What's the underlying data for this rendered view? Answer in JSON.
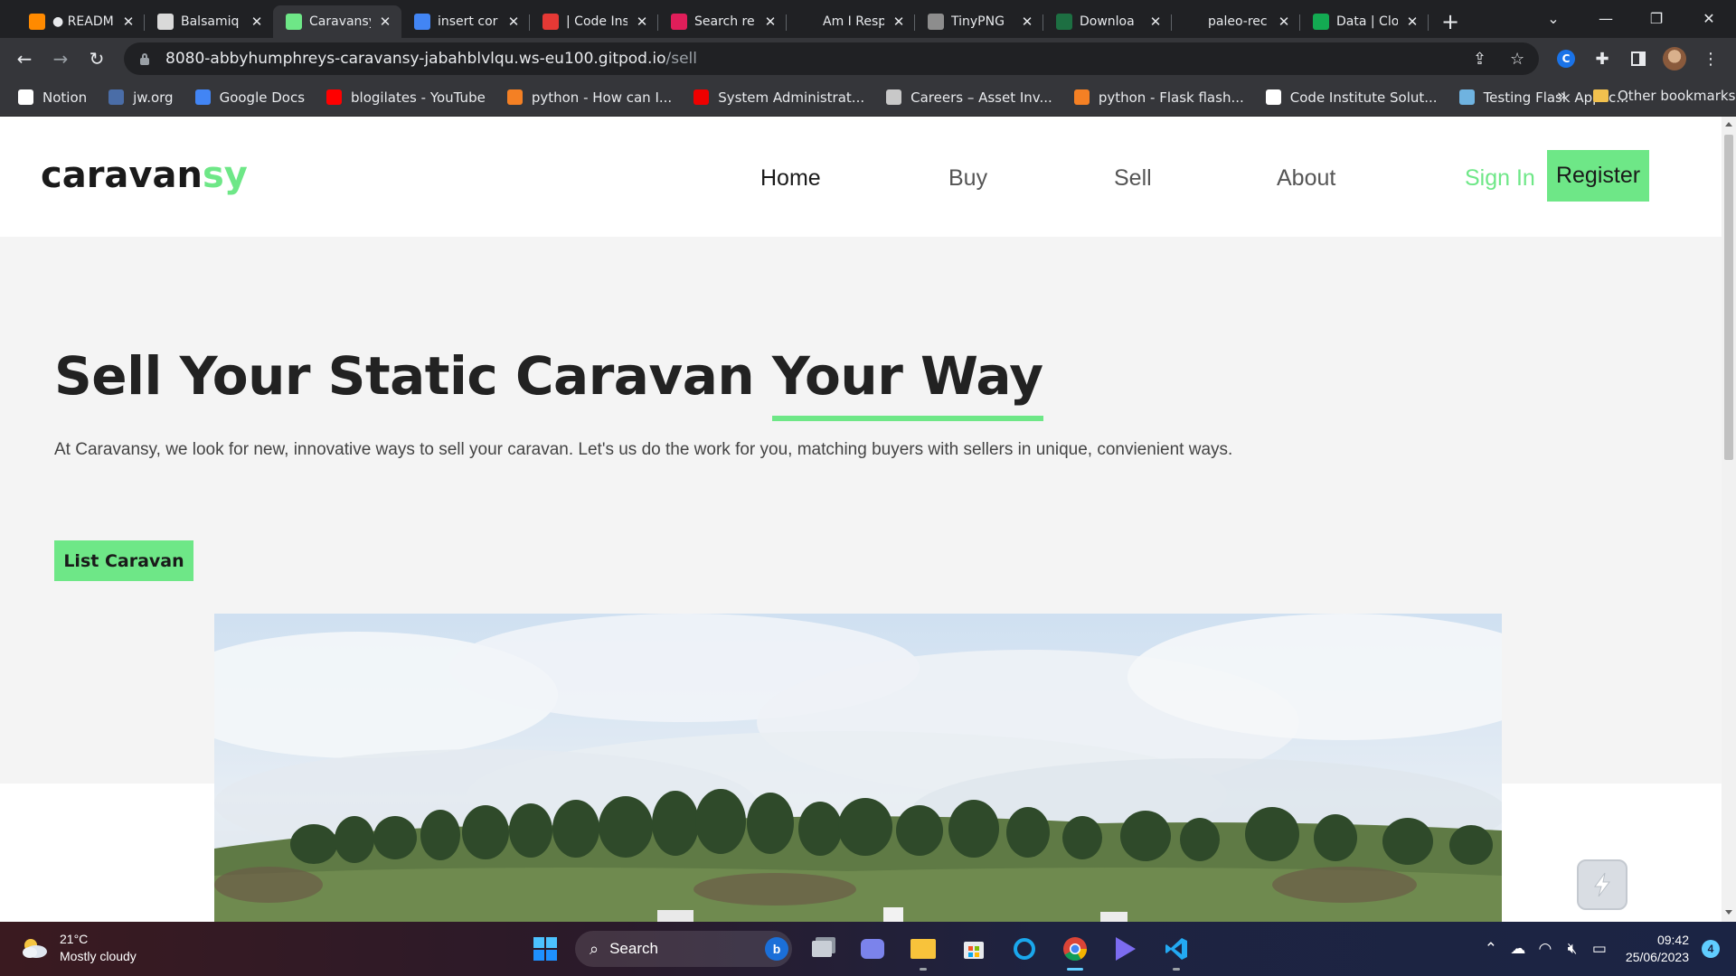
{
  "browser": {
    "tabs": [
      {
        "label": "● READM",
        "favicon": "gitpod-icon",
        "color": "#ff8a00",
        "active": false
      },
      {
        "label": "Balsamiq",
        "favicon": "balsamiq-icon",
        "color": "#d9d9d9",
        "active": false
      },
      {
        "label": "Caravansy",
        "favicon": "caravansy-icon",
        "color": "#6ee787",
        "active": true
      },
      {
        "label": "insert cor",
        "favicon": "google-icon",
        "color": "#4285f4",
        "active": false
      },
      {
        "label": "| Code Ins",
        "favicon": "opera-icon",
        "color": "#e53935",
        "active": false
      },
      {
        "label": "Search re",
        "favicon": "slack-icon",
        "color": "#e01e5a",
        "active": false
      },
      {
        "label": "Am I Resp",
        "favicon": "text-t-icon",
        "color": "#202124",
        "active": false
      },
      {
        "label": "TinyPNG",
        "favicon": "tinypng-icon",
        "color": "#8d8d8d",
        "active": false
      },
      {
        "label": "Downloa",
        "favicon": "excel-icon",
        "color": "#1d6f42",
        "active": false
      },
      {
        "label": "paleo-rec",
        "favicon": "github-icon",
        "color": "#202124",
        "active": false
      },
      {
        "label": "Data | Clo",
        "favicon": "mongodb-icon",
        "color": "#13aa52",
        "active": false
      }
    ],
    "address": {
      "host": "8080-abbyhumphreys-caravansy-jabahblvlqu.ws-eu100.gitpod.io",
      "path": "/sell"
    },
    "bookmarks": [
      {
        "label": "Notion",
        "icon": "notion-icon",
        "color": "#ffffff"
      },
      {
        "label": "jw.org",
        "icon": "jw-icon",
        "color": "#4a6da7"
      },
      {
        "label": "Google Docs",
        "icon": "google-docs-icon",
        "color": "#4285f4"
      },
      {
        "label": "blogilates - YouTube",
        "icon": "youtube-icon",
        "color": "#ff0000"
      },
      {
        "label": "python - How can I...",
        "icon": "stackoverflow-icon",
        "color": "#f48024"
      },
      {
        "label": "System Administrat...",
        "icon": "redhat-icon",
        "color": "#ee0000"
      },
      {
        "label": "Careers – Asset Inv...",
        "icon": "careers-icon",
        "color": "#c8c8c8"
      },
      {
        "label": "python - Flask flash...",
        "icon": "stackoverflow-icon",
        "color": "#f48024"
      },
      {
        "label": "Code Institute Solut...",
        "icon": "github-icon",
        "color": "#ffffff"
      },
      {
        "label": "Testing Flask Applic...",
        "icon": "cube-icon",
        "color": "#6fb3e0"
      }
    ],
    "bookmarks_overflow": "»",
    "other_bookmarks": "Other bookmarks"
  },
  "site": {
    "logo_main": "caravan",
    "logo_accent": "sy",
    "nav": [
      "Home",
      "Buy",
      "Sell",
      "About"
    ],
    "sign_in": "Sign In",
    "register": "Register",
    "accent_color": "#6ee787"
  },
  "hero": {
    "title_start": "Sell Your Static Caravan ",
    "title_underlined": "Your Way",
    "lead": "At Caravansy, we look for new, innovative ways to sell your caravan. Let's us do the work for you, matching buyers with sellers in unique, convienient ways.",
    "cta": "List Caravan"
  },
  "taskbar": {
    "weather_temp": "21°C",
    "weather_desc": "Mostly cloudy",
    "search": "Search",
    "time": "09:42",
    "date": "25/06/2023",
    "notifications": "4"
  }
}
